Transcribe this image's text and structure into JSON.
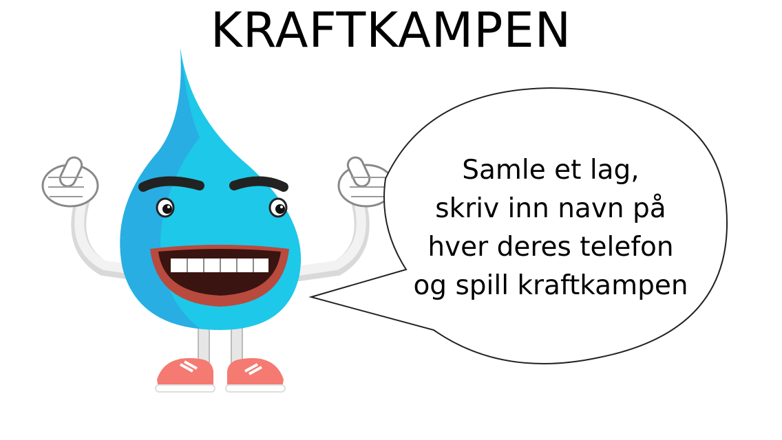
{
  "title": "KRAFTKAMPEN",
  "speech_bubble": {
    "lines": [
      "Samle et lag,",
      "skriv inn navn på",
      "hver deres telefon",
      "og spill kraftkampen"
    ]
  },
  "mascot": {
    "icon": "water-drop-mascot-icon",
    "body_color": "#1ec8e8",
    "shoe_color": "#f47a72",
    "mouth_color": "#b94a3e"
  }
}
